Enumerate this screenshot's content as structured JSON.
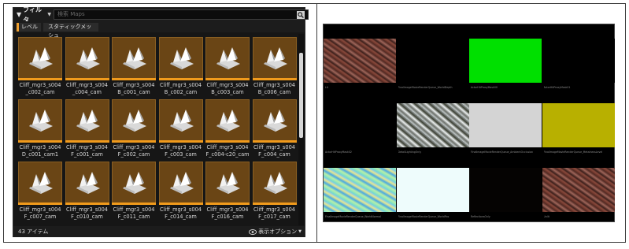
{
  "browser": {
    "filter_label": "フィルタ",
    "search_placeholder": "検索 Maps",
    "chips": [
      "レベル",
      "スタティックメッシュ"
    ],
    "assets": [
      {
        "row": 0,
        "labels": [
          "Cliff_mgr3_s004_c002_cam",
          "Cliff_mgr3_s004_c004_cam",
          "Cliff_mgr3_s004B_c001_cam",
          "Cliff_mgr3_s004B_c002_cam",
          "Cliff_mgr3_s004B_c003_cam",
          "Cliff_mgr3_s004B_c006_cam"
        ]
      },
      {
        "row": 1,
        "labels": [
          "Cliff_mgr3_s004D_c001_cam1",
          "Cliff_mgr3_s004F_c001_cam",
          "Cliff_mgr3_s004F_c002_cam",
          "Cliff_mgr3_s004F_c003_cam",
          "Cliff_mgr3_s004F_c004-c20_cam",
          "Cliff_mgr3_s004F_c004_cam"
        ]
      },
      {
        "row": 2,
        "labels": [
          "Cliff_mgr3_s004F_c007_cam",
          "Cliff_mgr3_s004F_c010_cam",
          "Cliff_mgr3_s004F_c011_cam",
          "Cliff_mgr3_s004F_c014_cam",
          "Cliff_mgr3_s004F_c016_cam",
          "Cliff_mgr3_s004F_c017_cam"
        ]
      }
    ],
    "item_count": "43 アイテム",
    "view_options": "表示オプション",
    "colors": {
      "thumb_bg": "#6a4515",
      "accent_bar": "#f09a1c",
      "scroll_thumb": "#d6d6d6"
    }
  },
  "passes": [
    {
      "label": "Lit",
      "fill": "rock-red"
    },
    {
      "label": "FinalImageMovieRenderQueue_WorldDepth",
      "fill": "#000000"
    },
    {
      "label": "ActorHitProxyMask00",
      "fill": "#00e000"
    },
    {
      "label": "ActorHitProxyMask01",
      "fill": "#000000"
    },
    {
      "label": "ActorHitProxyMask02",
      "fill": "#000000"
    },
    {
      "label": "DetailLightingOnly",
      "fill": "rock-gray"
    },
    {
      "label": "FinalImageMovieRenderQueue_AmbientOcclusion",
      "fill": "#d4d4d4"
    },
    {
      "label": "FinalImageMovieRenderQueue_MetalnessLevel",
      "fill": "#b8b000"
    },
    {
      "label": "FinalImageMovieRenderQueue_WorldNormal",
      "fill": "normal-map"
    },
    {
      "label": "FinalImageMovieRenderQueue_WorldPos",
      "fill": "#eefcfc"
    },
    {
      "label": "ReflectionsOnly",
      "fill": "#050302"
    },
    {
      "label": "Unlit",
      "fill": "rock-red"
    }
  ]
}
